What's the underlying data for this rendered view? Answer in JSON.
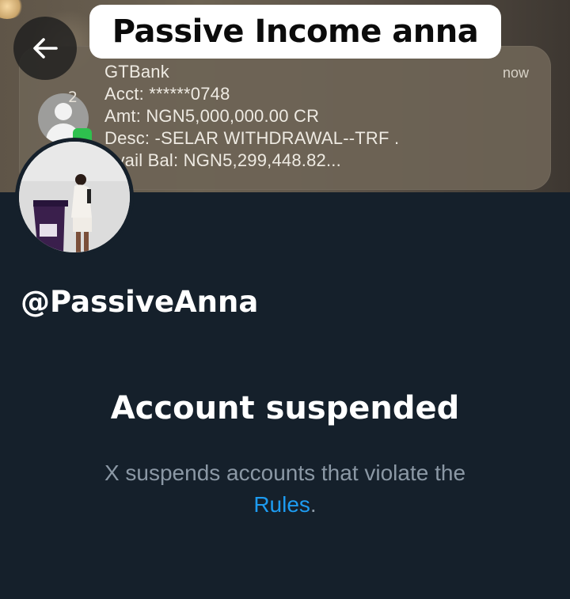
{
  "header": {
    "title": "Passive Income anna",
    "back_icon": "arrow-left-icon"
  },
  "notification": {
    "sender": "GTBank",
    "time": "now",
    "count": "2",
    "acct_line": "Acct: ******0748",
    "amt_line": "Amt: NGN5,000,000.00 CR",
    "desc_line": "Desc: -SELAR WITHDRAWAL--TRF .",
    "bal_line": "Avail Bal: NGN5,299,448.82..."
  },
  "profile": {
    "handle": "@PassiveAnna",
    "avatar_icon": "profile-photo"
  },
  "suspension": {
    "title": "Account suspended",
    "message": "X suspends accounts that violate the",
    "link_text": "Rules",
    "trailing": "."
  },
  "colors": {
    "background": "#15202b",
    "link": "#1d9bf0",
    "muted_text": "#8b98a5"
  }
}
